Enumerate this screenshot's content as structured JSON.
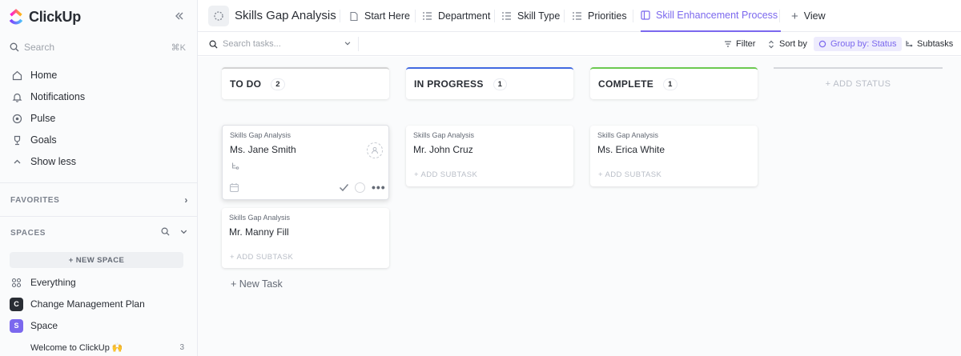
{
  "app": {
    "name": "ClickUp"
  },
  "sidebar": {
    "search_label": "Search",
    "search_shortcut": "⌘K",
    "nav": [
      {
        "label": "Home",
        "icon": "home-icon"
      },
      {
        "label": "Notifications",
        "icon": "bell-icon"
      },
      {
        "label": "Pulse",
        "icon": "pulse-icon"
      },
      {
        "label": "Goals",
        "icon": "trophy-icon"
      },
      {
        "label": "Show less",
        "icon": "chevron-up-icon"
      }
    ],
    "favorites_label": "FAVORITES",
    "spaces_label": "SPACES",
    "new_space_label": "+ NEW SPACE",
    "spaces": [
      {
        "label": "Everything",
        "avatar": "",
        "color": ""
      },
      {
        "label": "Change Management Plan",
        "avatar": "C",
        "color": "#292d34"
      },
      {
        "label": "Space",
        "avatar": "S",
        "color": "#7b68ee"
      }
    ],
    "list_item": {
      "label": "Welcome to ClickUp 🙌",
      "count": "3"
    }
  },
  "header": {
    "title": "Skills Gap Analysis",
    "tabs": [
      {
        "label": "Start Here",
        "active": false
      },
      {
        "label": "Department",
        "active": false
      },
      {
        "label": "Skill Type",
        "active": false
      },
      {
        "label": "Priorities",
        "active": false
      },
      {
        "label": "Skill Enhancement Process",
        "active": true
      }
    ],
    "add_view_label": "View"
  },
  "toolbar": {
    "search_placeholder": "Search tasks...",
    "filter_label": "Filter",
    "sort_label": "Sort by",
    "group_label": "Group by: Status",
    "subtasks_label": "Subtasks"
  },
  "board": {
    "columns": [
      {
        "title": "TO DO",
        "count": "2",
        "color": "#d3d3d3"
      },
      {
        "title": "IN PROGRESS",
        "count": "1",
        "color": "#4169e1"
      },
      {
        "title": "COMPLETE",
        "count": "1",
        "color": "#6bc950"
      }
    ],
    "add_status_label": "+ ADD STATUS",
    "cards": {
      "todo": [
        {
          "list": "Skills Gap Analysis",
          "name": "Ms. Jane Smith"
        },
        {
          "list": "Skills Gap Analysis",
          "name": "Mr. Manny Fill",
          "add_subtask": "+ ADD SUBTASK"
        }
      ],
      "in_progress": [
        {
          "list": "Skills Gap Analysis",
          "name": "Mr. John Cruz",
          "add_subtask": "+ ADD SUBTASK"
        }
      ],
      "complete": [
        {
          "list": "Skills Gap Analysis",
          "name": "Ms. Erica White",
          "add_subtask": "+ ADD SUBTASK"
        }
      ]
    },
    "new_task_label": "+ New Task"
  }
}
